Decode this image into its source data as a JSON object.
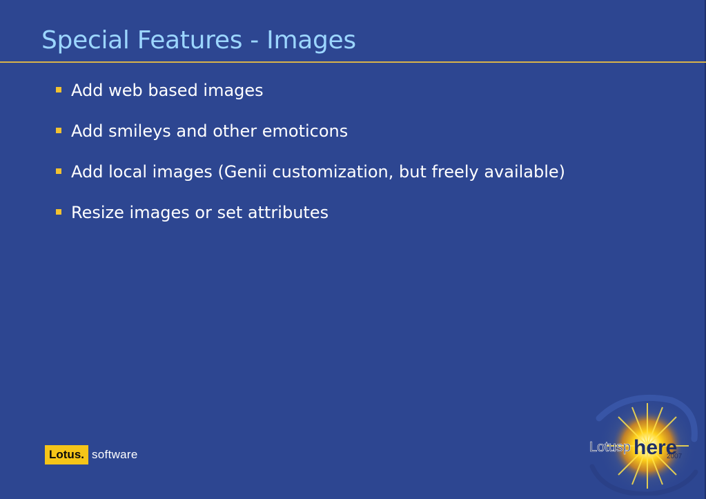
{
  "slide": {
    "title": "Special Features - Images",
    "bullets": [
      "Add web based images",
      "Add smileys and other emoticons",
      "Add local images (Genii customization, but freely available)",
      "Resize images or set attributes"
    ]
  },
  "footer": {
    "lotus_brand": "Lotus.",
    "lotus_suffix": "software",
    "event_logo": {
      "prefix": "Lotusp",
      "word": "here",
      "year": "2007"
    }
  },
  "colors": {
    "background": "#2d4691",
    "title": "#9cd6ff",
    "rule": "#d9b44a",
    "bullet_marker": "#f2c230",
    "body_text": "#ffffff",
    "lotus_box": "#f5c518"
  }
}
